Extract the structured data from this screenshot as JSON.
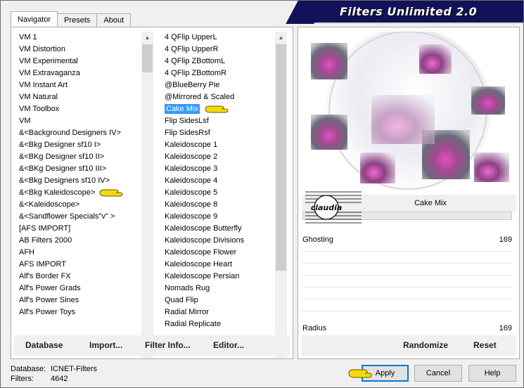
{
  "window": {
    "title": "Filters Unlimited 2.0"
  },
  "tabs": [
    "Navigator",
    "Presets",
    "About"
  ],
  "categories": [
    "VM 1",
    "VM Distortion",
    "VM Experimental",
    "VM Extravaganza",
    "VM Instant Art",
    "VM Natural",
    "VM Toolbox",
    "VM",
    "&<Background Designers IV>",
    "&<Bkg Designer sf10 I>",
    "&<BKg Designer sf10 II>",
    "&<BKg Designer sf10 III>",
    "&<Bkg Designers sf10 IV>",
    "&<Bkg Kaleidoscope>",
    "&<Kaleidoscope>",
    "&<Sandflower Specials\"v\" >",
    "[AFS IMPORT]",
    "AB Filters 2000",
    "AFH",
    "AFS IMPORT",
    "Alf's Border FX",
    "Alf's Power Grads",
    "Alf's Power Sines",
    "Alf's Power Toys"
  ],
  "filters": [
    "4 QFlip UpperL",
    "4 QFlip UpperR",
    "4 QFlip ZBottomL",
    "4 QFlip ZBottomR",
    "@BlueBerry Pie",
    "@Mirrored & Scaled",
    "Cake Mix",
    "Flip SidesLsf",
    "Flip SidesRsf",
    "Kaleidoscope 1",
    "Kaleidoscope 2",
    "Kaleidoscope 3",
    "Kaleidoscope 4",
    "Kaleidoscope 5",
    "Kaleidoscope 8",
    "Kaleidoscope 9",
    "Kaleidoscope Butterfly",
    "Kaleidoscope Divisions",
    "Kaleidoscope Flower",
    "Kaleidoscope Heart",
    "Kaleidoscope Persian",
    "Nomads Rug",
    "Quad Flip",
    "Radial Mirror",
    "Radial Replicate"
  ],
  "selected_filter": "Cake Mix",
  "left_toolbar": {
    "database": "Database",
    "import": "Import...",
    "filter_info": "Filter Info...",
    "editor": "Editor..."
  },
  "preview": {
    "filter_name": "Cake Mix",
    "logo_text": "claudia"
  },
  "sliders": [
    {
      "label": "Ghosting",
      "value": "169"
    },
    {
      "label": "Radius",
      "value": "169"
    }
  ],
  "right_toolbar": {
    "randomize": "Randomize",
    "reset": "Reset"
  },
  "status": {
    "database_label": "Database:",
    "database_value": "ICNET-Filters",
    "filters_label": "Filters:",
    "filters_value": "4642"
  },
  "buttons": {
    "apply": "Apply",
    "cancel": "Cancel",
    "help": "Help"
  },
  "colors": {
    "title_bar": "#12125a",
    "selection": "#3399ff",
    "accent": "#0078d7",
    "pointer": "#f5d90a"
  }
}
